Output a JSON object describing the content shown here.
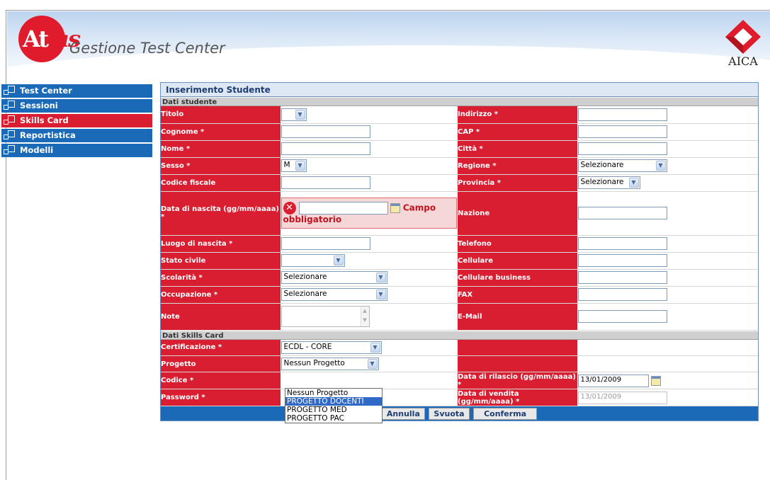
{
  "header": {
    "logo_text_a": "At",
    "logo_text_b": "las",
    "app_title": "Gestione Test Center",
    "partner_logo": "AICA"
  },
  "menu": [
    {
      "label": "Test Center",
      "active": false
    },
    {
      "label": "Sessioni",
      "active": false
    },
    {
      "label": "Skills Card",
      "active": true
    },
    {
      "label": "Reportistica",
      "active": false
    },
    {
      "label": "Modelli",
      "active": false
    }
  ],
  "form": {
    "title": "Inserimento Studente",
    "section_student": "Dati studente",
    "section_card": "Dati Skills Card",
    "titolo_label": "Titolo",
    "cognome_label": "Cognome *",
    "nome_label": "Nome *",
    "sesso_label": "Sesso *",
    "sesso_value": "M",
    "codice_fiscale_label": "Codice fiscale",
    "data_nascita_label": "Data di nascita (gg/mm/aaaa) *",
    "data_nascita_error": "Campo obbligatorio",
    "luogo_nascita_label": "Luogo di nascita *",
    "stato_civile_label": "Stato civile",
    "scolarita_label": "Scolarità *",
    "scolarita_value": "Selezionare",
    "occupazione_label": "Occupazione *",
    "occupazione_value": "Selezionare",
    "note_label": "Note",
    "indirizzo_label": "Indirizzo *",
    "cap_label": "CAP *",
    "citta_label": "Città *",
    "regione_label": "Regione *",
    "regione_value": "Selezionare",
    "provincia_label": "Provincia *",
    "provincia_value": "Selezionare",
    "nazione_label": "Nazione",
    "telefono_label": "Telefono",
    "cellulare_label": "Cellulare",
    "cellulare_business_label": "Cellulare business",
    "fax_label": "FAX",
    "email_label": "E-Mail",
    "certificazione_label": "Certificazione *",
    "certificazione_value": "ECDL - CORE",
    "progetto_label": "Progetto",
    "progetto_value": "Nessun Progetto",
    "progetto_options": [
      "Nessun Progetto",
      "PROGETTO DOCENTI",
      "PROGETTO MED",
      "PROGETTO PAC"
    ],
    "codice_label": "Codice *",
    "password_label": "Password *",
    "data_rilascio_label": "Data di rilascio (gg/mm/aaaa) *",
    "data_rilascio_value": "13/01/2009",
    "data_vendita_label": "Data di vendita (gg/mm/aaaa) *",
    "data_vendita_value": "13/01/2009"
  },
  "buttons": {
    "annulla": "Annulla",
    "svuota": "Svuota",
    "conferma": "Conferma"
  },
  "colors": {
    "menu_blue": "#1a6ab8",
    "active_red": "#d81e30",
    "panel_header": "#dde8f4"
  }
}
